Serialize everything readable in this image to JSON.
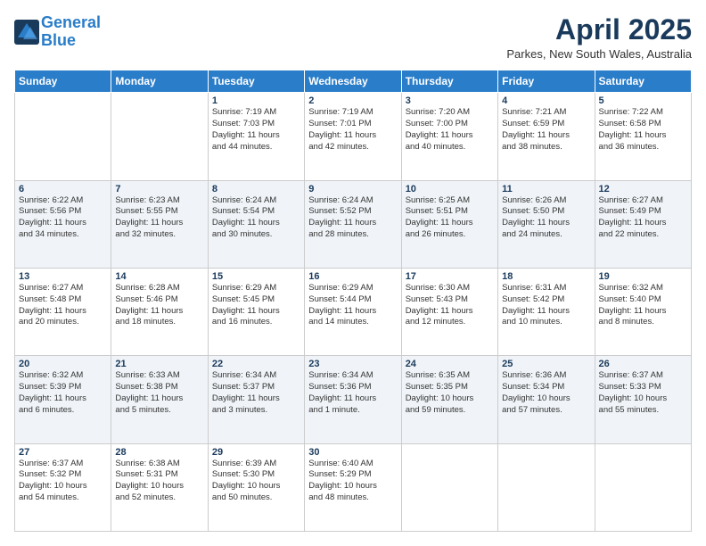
{
  "header": {
    "logo_line1": "General",
    "logo_line2": "Blue",
    "month_title": "April 2025",
    "subtitle": "Parkes, New South Wales, Australia"
  },
  "weekdays": [
    "Sunday",
    "Monday",
    "Tuesday",
    "Wednesday",
    "Thursday",
    "Friday",
    "Saturday"
  ],
  "weeks": [
    [
      {
        "day": "",
        "info": ""
      },
      {
        "day": "",
        "info": ""
      },
      {
        "day": "1",
        "info": "Sunrise: 7:19 AM\nSunset: 7:03 PM\nDaylight: 11 hours\nand 44 minutes."
      },
      {
        "day": "2",
        "info": "Sunrise: 7:19 AM\nSunset: 7:01 PM\nDaylight: 11 hours\nand 42 minutes."
      },
      {
        "day": "3",
        "info": "Sunrise: 7:20 AM\nSunset: 7:00 PM\nDaylight: 11 hours\nand 40 minutes."
      },
      {
        "day": "4",
        "info": "Sunrise: 7:21 AM\nSunset: 6:59 PM\nDaylight: 11 hours\nand 38 minutes."
      },
      {
        "day": "5",
        "info": "Sunrise: 7:22 AM\nSunset: 6:58 PM\nDaylight: 11 hours\nand 36 minutes."
      }
    ],
    [
      {
        "day": "6",
        "info": "Sunrise: 6:22 AM\nSunset: 5:56 PM\nDaylight: 11 hours\nand 34 minutes."
      },
      {
        "day": "7",
        "info": "Sunrise: 6:23 AM\nSunset: 5:55 PM\nDaylight: 11 hours\nand 32 minutes."
      },
      {
        "day": "8",
        "info": "Sunrise: 6:24 AM\nSunset: 5:54 PM\nDaylight: 11 hours\nand 30 minutes."
      },
      {
        "day": "9",
        "info": "Sunrise: 6:24 AM\nSunset: 5:52 PM\nDaylight: 11 hours\nand 28 minutes."
      },
      {
        "day": "10",
        "info": "Sunrise: 6:25 AM\nSunset: 5:51 PM\nDaylight: 11 hours\nand 26 minutes."
      },
      {
        "day": "11",
        "info": "Sunrise: 6:26 AM\nSunset: 5:50 PM\nDaylight: 11 hours\nand 24 minutes."
      },
      {
        "day": "12",
        "info": "Sunrise: 6:27 AM\nSunset: 5:49 PM\nDaylight: 11 hours\nand 22 minutes."
      }
    ],
    [
      {
        "day": "13",
        "info": "Sunrise: 6:27 AM\nSunset: 5:48 PM\nDaylight: 11 hours\nand 20 minutes."
      },
      {
        "day": "14",
        "info": "Sunrise: 6:28 AM\nSunset: 5:46 PM\nDaylight: 11 hours\nand 18 minutes."
      },
      {
        "day": "15",
        "info": "Sunrise: 6:29 AM\nSunset: 5:45 PM\nDaylight: 11 hours\nand 16 minutes."
      },
      {
        "day": "16",
        "info": "Sunrise: 6:29 AM\nSunset: 5:44 PM\nDaylight: 11 hours\nand 14 minutes."
      },
      {
        "day": "17",
        "info": "Sunrise: 6:30 AM\nSunset: 5:43 PM\nDaylight: 11 hours\nand 12 minutes."
      },
      {
        "day": "18",
        "info": "Sunrise: 6:31 AM\nSunset: 5:42 PM\nDaylight: 11 hours\nand 10 minutes."
      },
      {
        "day": "19",
        "info": "Sunrise: 6:32 AM\nSunset: 5:40 PM\nDaylight: 11 hours\nand 8 minutes."
      }
    ],
    [
      {
        "day": "20",
        "info": "Sunrise: 6:32 AM\nSunset: 5:39 PM\nDaylight: 11 hours\nand 6 minutes."
      },
      {
        "day": "21",
        "info": "Sunrise: 6:33 AM\nSunset: 5:38 PM\nDaylight: 11 hours\nand 5 minutes."
      },
      {
        "day": "22",
        "info": "Sunrise: 6:34 AM\nSunset: 5:37 PM\nDaylight: 11 hours\nand 3 minutes."
      },
      {
        "day": "23",
        "info": "Sunrise: 6:34 AM\nSunset: 5:36 PM\nDaylight: 11 hours\nand 1 minute."
      },
      {
        "day": "24",
        "info": "Sunrise: 6:35 AM\nSunset: 5:35 PM\nDaylight: 10 hours\nand 59 minutes."
      },
      {
        "day": "25",
        "info": "Sunrise: 6:36 AM\nSunset: 5:34 PM\nDaylight: 10 hours\nand 57 minutes."
      },
      {
        "day": "26",
        "info": "Sunrise: 6:37 AM\nSunset: 5:33 PM\nDaylight: 10 hours\nand 55 minutes."
      }
    ],
    [
      {
        "day": "27",
        "info": "Sunrise: 6:37 AM\nSunset: 5:32 PM\nDaylight: 10 hours\nand 54 minutes."
      },
      {
        "day": "28",
        "info": "Sunrise: 6:38 AM\nSunset: 5:31 PM\nDaylight: 10 hours\nand 52 minutes."
      },
      {
        "day": "29",
        "info": "Sunrise: 6:39 AM\nSunset: 5:30 PM\nDaylight: 10 hours\nand 50 minutes."
      },
      {
        "day": "30",
        "info": "Sunrise: 6:40 AM\nSunset: 5:29 PM\nDaylight: 10 hours\nand 48 minutes."
      },
      {
        "day": "",
        "info": ""
      },
      {
        "day": "",
        "info": ""
      },
      {
        "day": "",
        "info": ""
      }
    ]
  ]
}
